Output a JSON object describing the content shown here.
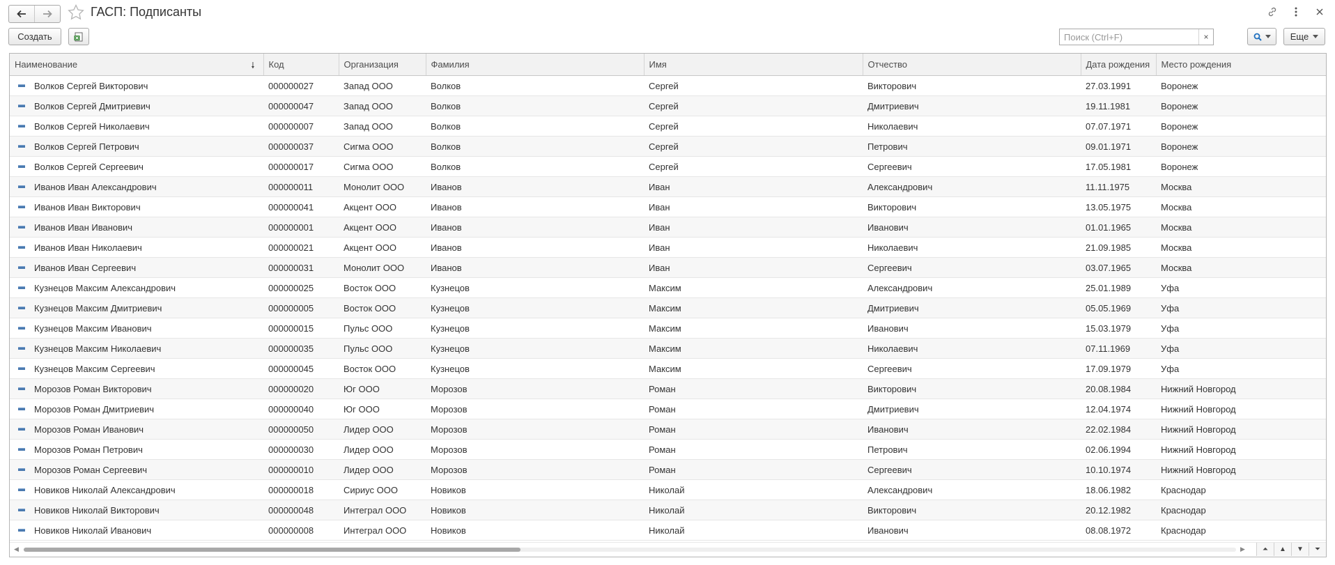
{
  "window": {
    "title": "ГАСП: Подписанты"
  },
  "toolbar": {
    "create_label": "Создать",
    "search_placeholder": "Поиск (Ctrl+F)",
    "clear_label": "×",
    "more_label": "Еще"
  },
  "table": {
    "columns": [
      "Наименование",
      "Код",
      "Организация",
      "Фамилия",
      "Имя",
      "Отчество",
      "Дата рождения",
      "Место рождения"
    ],
    "sort_column": "Наименование",
    "rows": [
      [
        "Волков Сергей Викторович",
        "000000027",
        "Запад ООО",
        "Волков",
        "Сергей",
        "Викторович",
        "27.03.1991",
        "Воронеж"
      ],
      [
        "Волков Сергей Дмитриевич",
        "000000047",
        "Запад ООО",
        "Волков",
        "Сергей",
        "Дмитриевич",
        "19.11.1981",
        "Воронеж"
      ],
      [
        "Волков Сергей Николаевич",
        "000000007",
        "Запад ООО",
        "Волков",
        "Сергей",
        "Николаевич",
        "07.07.1971",
        "Воронеж"
      ],
      [
        "Волков Сергей Петрович",
        "000000037",
        "Сигма ООО",
        "Волков",
        "Сергей",
        "Петрович",
        "09.01.1971",
        "Воронеж"
      ],
      [
        "Волков Сергей Сергеевич",
        "000000017",
        "Сигма ООО",
        "Волков",
        "Сергей",
        "Сергеевич",
        "17.05.1981",
        "Воронеж"
      ],
      [
        "Иванов Иван Александрович",
        "000000011",
        "Монолит ООО",
        "Иванов",
        "Иван",
        "Александрович",
        "11.11.1975",
        "Москва"
      ],
      [
        "Иванов Иван Викторович",
        "000000041",
        "Акцент ООО",
        "Иванов",
        "Иван",
        "Викторович",
        "13.05.1975",
        "Москва"
      ],
      [
        "Иванов Иван Иванович",
        "000000001",
        "Акцент ООО",
        "Иванов",
        "Иван",
        "Иванович",
        "01.01.1965",
        "Москва"
      ],
      [
        "Иванов Иван Николаевич",
        "000000021",
        "Акцент ООО",
        "Иванов",
        "Иван",
        "Николаевич",
        "21.09.1985",
        "Москва"
      ],
      [
        "Иванов Иван Сергеевич",
        "000000031",
        "Монолит ООО",
        "Иванов",
        "Иван",
        "Сергеевич",
        "03.07.1965",
        "Москва"
      ],
      [
        "Кузнецов Максим Александрович",
        "000000025",
        "Восток ООО",
        "Кузнецов",
        "Максим",
        "Александрович",
        "25.01.1989",
        "Уфа"
      ],
      [
        "Кузнецов Максим Дмитриевич",
        "000000005",
        "Восток ООО",
        "Кузнецов",
        "Максим",
        "Дмитриевич",
        "05.05.1969",
        "Уфа"
      ],
      [
        "Кузнецов Максим Иванович",
        "000000015",
        "Пульс ООО",
        "Кузнецов",
        "Максим",
        "Иванович",
        "15.03.1979",
        "Уфа"
      ],
      [
        "Кузнецов Максим Николаевич",
        "000000035",
        "Пульс ООО",
        "Кузнецов",
        "Максим",
        "Николаевич",
        "07.11.1969",
        "Уфа"
      ],
      [
        "Кузнецов Максим Сергеевич",
        "000000045",
        "Восток ООО",
        "Кузнецов",
        "Максим",
        "Сергеевич",
        "17.09.1979",
        "Уфа"
      ],
      [
        "Морозов Роман Викторович",
        "000000020",
        "Юг ООО",
        "Морозов",
        "Роман",
        "Викторович",
        "20.08.1984",
        "Нижний Новгород"
      ],
      [
        "Морозов Роман Дмитриевич",
        "000000040",
        "Юг ООО",
        "Морозов",
        "Роман",
        "Дмитриевич",
        "12.04.1974",
        "Нижний Новгород"
      ],
      [
        "Морозов Роман Иванович",
        "000000050",
        "Лидер ООО",
        "Морозов",
        "Роман",
        "Иванович",
        "22.02.1984",
        "Нижний Новгород"
      ],
      [
        "Морозов Роман Петрович",
        "000000030",
        "Лидер ООО",
        "Морозов",
        "Роман",
        "Петрович",
        "02.06.1994",
        "Нижний Новгород"
      ],
      [
        "Морозов Роман Сергеевич",
        "000000010",
        "Лидер ООО",
        "Морозов",
        "Роман",
        "Сергеевич",
        "10.10.1974",
        "Нижний Новгород"
      ],
      [
        "Новиков Николай Александрович",
        "000000018",
        "Сириус ООО",
        "Новиков",
        "Николай",
        "Александрович",
        "18.06.1982",
        "Краснодар"
      ],
      [
        "Новиков Николай Викторович",
        "000000048",
        "Интеграл ООО",
        "Новиков",
        "Николай",
        "Викторович",
        "20.12.1982",
        "Краснодар"
      ],
      [
        "Новиков Николай Иванович",
        "000000008",
        "Интеграл ООО",
        "Новиков",
        "Николай",
        "Иванович",
        "08.08.1972",
        "Краснодар"
      ]
    ]
  },
  "scroll": {
    "horizontal_fraction": 0.41
  },
  "icons": {
    "back": "arrow-left-icon",
    "forward": "arrow-right-icon",
    "favorite": "star-icon",
    "link": "link-icon",
    "menu": "more-vertical-icon",
    "close": "close-icon",
    "save": "save-excel-icon",
    "search": "search-icon",
    "row": "catalog-item-icon"
  },
  "colors": {
    "accent": "#4a7ab0",
    "header_bg": "#f2f2f2",
    "border": "#b5b5b5"
  }
}
